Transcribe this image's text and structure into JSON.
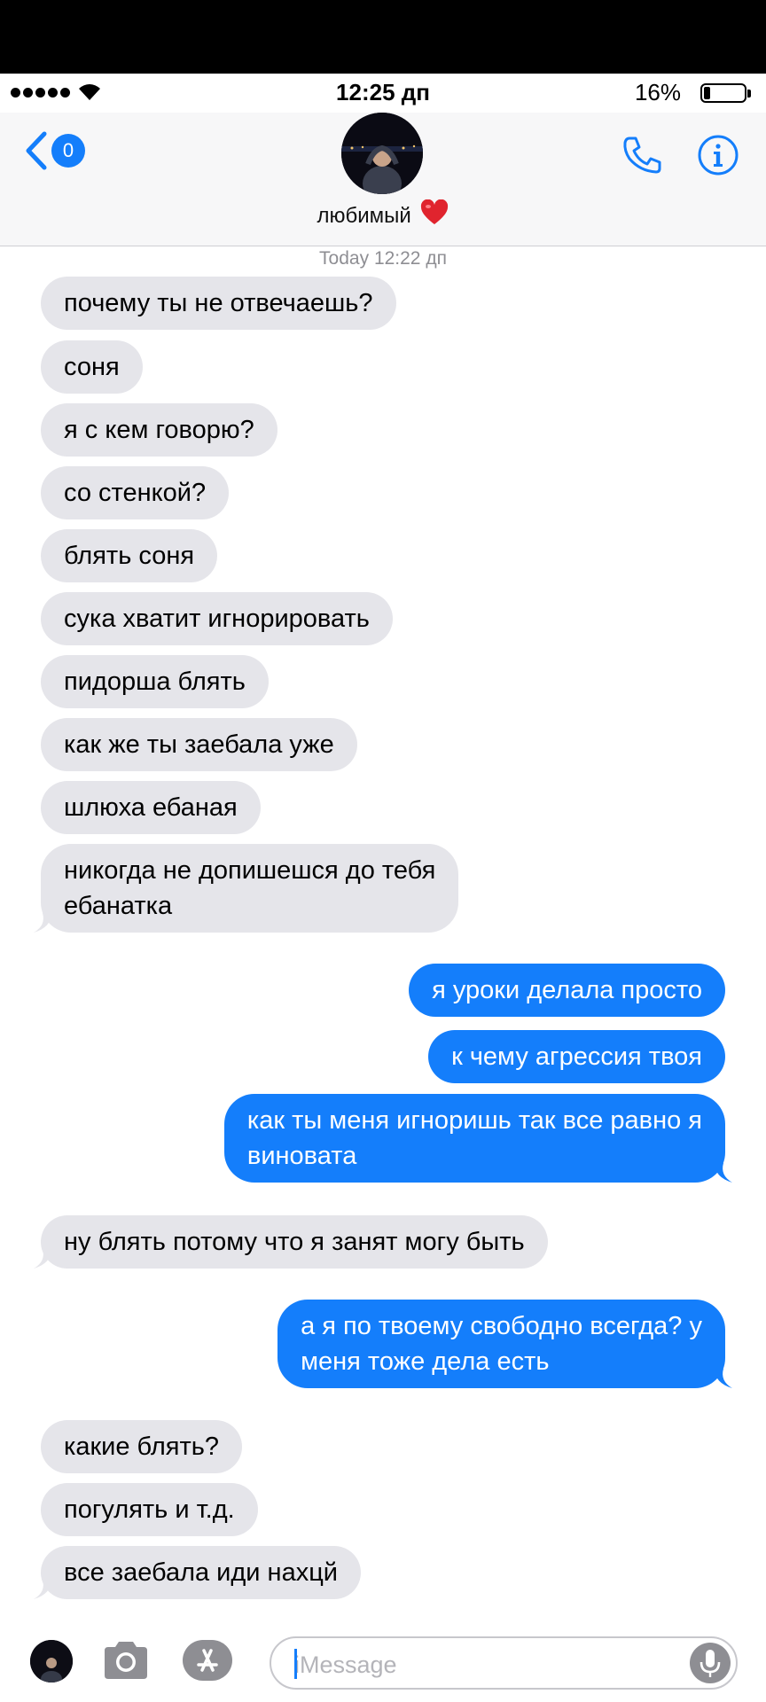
{
  "status_bar": {
    "time": "12:25 дп",
    "battery_percent": "16%",
    "battery_level": 0.16
  },
  "header": {
    "back_badge_count": "0",
    "contact_name": "любимый",
    "contact_emoji": "heart-icon"
  },
  "conversation": {
    "timestamp_day": "Today",
    "timestamp_time": "12:22 дп",
    "messages": [
      {
        "from": "them",
        "text": "почему ты не отвечаешь?"
      },
      {
        "from": "them",
        "text": "соня"
      },
      {
        "from": "them",
        "text": "я с кем говорю?"
      },
      {
        "from": "them",
        "text": "со стенкой?"
      },
      {
        "from": "them",
        "text": "блять соня"
      },
      {
        "from": "them",
        "text": "сука хватит игнорировать"
      },
      {
        "from": "them",
        "text": "пидорша блять"
      },
      {
        "from": "them",
        "text": "как же ты заебала уже"
      },
      {
        "from": "them",
        "text": "шлюха ебаная"
      },
      {
        "from": "them",
        "line1": "никогда не допишешся до тебя",
        "line2": "ебанатка"
      },
      {
        "from": "me",
        "text": "я уроки делала просто"
      },
      {
        "from": "me",
        "text": "к чему агрессия твоя"
      },
      {
        "from": "me",
        "line1": "как ты меня игноришь так все равно я",
        "line2": "виновата"
      },
      {
        "from": "them",
        "text": "ну блять потому что я занят могу быть"
      },
      {
        "from": "me",
        "line1": "а я по твоему свободно всегда? у",
        "line2": "меня тоже дела есть"
      },
      {
        "from": "them",
        "text": "какие блять?"
      },
      {
        "from": "them",
        "text": "погулять и т.д."
      },
      {
        "from": "them",
        "text": "все заебала иди нахцй"
      }
    ]
  },
  "composer": {
    "placeholder": "iMessage",
    "value": ""
  },
  "colors": {
    "accent": "#147efb",
    "incoming_bubble": "#e5e5ea",
    "outgoing_bubble": "#147efb"
  }
}
